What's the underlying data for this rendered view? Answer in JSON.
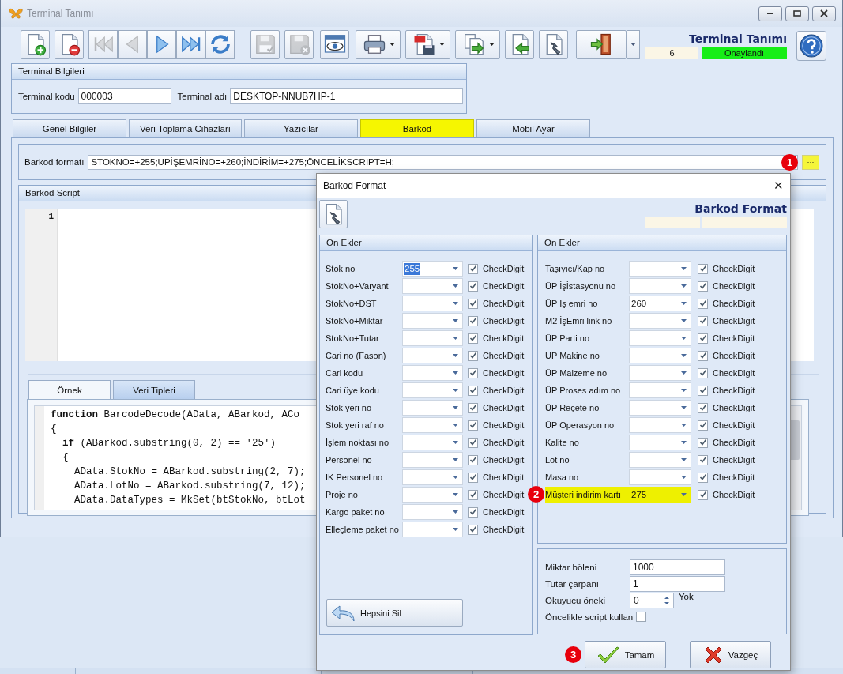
{
  "window": {
    "title": "Terminal Tanımı"
  },
  "toolbar": {
    "buttons": [
      {
        "kind": "new",
        "disabled": false,
        "dropdown": false
      },
      {
        "kind": "delete",
        "disabled": false,
        "dropdown": false
      },
      {
        "kind": "first",
        "disabled": true,
        "dropdown": false
      },
      {
        "kind": "prev",
        "disabled": true,
        "dropdown": false
      },
      {
        "kind": "next",
        "disabled": false,
        "dropdown": false
      },
      {
        "kind": "last",
        "disabled": false,
        "dropdown": false
      },
      {
        "kind": "refresh",
        "disabled": false,
        "dropdown": false
      },
      {
        "kind": "save",
        "disabled": true,
        "dropdown": false
      },
      {
        "kind": "save-cancel",
        "disabled": true,
        "dropdown": false
      },
      {
        "kind": "preview",
        "disabled": false,
        "dropdown": false
      },
      {
        "kind": "print",
        "disabled": false,
        "dropdown": true
      },
      {
        "kind": "pdf",
        "disabled": false,
        "dropdown": true
      },
      {
        "kind": "copy",
        "disabled": false,
        "dropdown": true
      },
      {
        "kind": "import",
        "disabled": false,
        "dropdown": false
      },
      {
        "kind": "tools",
        "disabled": false,
        "dropdown": false
      },
      {
        "kind": "exit",
        "disabled": false,
        "dropdown": true
      }
    ],
    "header": {
      "title": "Terminal Tanımı",
      "number": "6",
      "status": "Onaylandı"
    }
  },
  "terminal_info": {
    "title": "Terminal Bilgileri",
    "fields": [
      {
        "label": "Terminal kodu",
        "value": "000003"
      },
      {
        "label": "Terminal adı",
        "value": "DESKTOP-NNUB7HP-1"
      }
    ]
  },
  "tabs": [
    {
      "label": "Genel Bilgiler",
      "selected": false
    },
    {
      "label": "Veri Toplama Cihazları",
      "selected": false
    },
    {
      "label": "Yazıcılar",
      "selected": false
    },
    {
      "label": "Barkod",
      "selected": true
    },
    {
      "label": "Mobil Ayar",
      "selected": false
    }
  ],
  "barcode_format": {
    "label": "Barkod formatı",
    "value": "STOKNO=+255;UPİŞEMRİNO=+260;İNDİRİM=+275;ÖNCELİKSCRIPT=H;",
    "button": "···",
    "badge": "1"
  },
  "barcode_script": {
    "title": "Barkod Script",
    "line_numbers": [
      "1"
    ],
    "example_tabs": [
      {
        "label": "Örnek",
        "selected": true
      },
      {
        "label": "Veri Tipleri",
        "selected": false
      }
    ],
    "code": [
      "**function** BarcodeDecode(AData, ABarkod, ACo",
      "{",
      "  **if** (ABarkod.substring(0, 2) == '25')",
      "  {",
      "    AData.StokNo = ABarkod.substring(2, 7);",
      "    AData.LotNo = ABarkod.substring(7, 12);",
      "    AData.DataTypes = MkSet(btStokNo, btLot"
    ]
  },
  "dialog": {
    "title": "Barkod Format",
    "close": "✕",
    "header": "Barkod Format",
    "left": {
      "title": "Ön Ekler",
      "rows": [
        {
          "label": "Stok no",
          "value": "255",
          "value_selected": true,
          "checked": true,
          "check_label": "CheckDigit",
          "highlighted": false
        },
        {
          "label": "StokNo+Varyant",
          "value": "",
          "value_selected": false,
          "checked": true,
          "check_label": "CheckDigit",
          "highlighted": false
        },
        {
          "label": "StokNo+DST",
          "value": "",
          "value_selected": false,
          "checked": true,
          "check_label": "CheckDigit",
          "highlighted": false
        },
        {
          "label": "StokNo+Miktar",
          "value": "",
          "value_selected": false,
          "checked": true,
          "check_label": "CheckDigit",
          "highlighted": false
        },
        {
          "label": "StokNo+Tutar",
          "value": "",
          "value_selected": false,
          "checked": true,
          "check_label": "CheckDigit",
          "highlighted": false
        },
        {
          "label": "Cari no (Fason)",
          "value": "",
          "value_selected": false,
          "checked": true,
          "check_label": "CheckDigit",
          "highlighted": false
        },
        {
          "label": "Cari kodu",
          "value": "",
          "value_selected": false,
          "checked": true,
          "check_label": "CheckDigit",
          "highlighted": false
        },
        {
          "label": "Cari üye kodu",
          "value": "",
          "value_selected": false,
          "checked": true,
          "check_label": "CheckDigit",
          "highlighted": false
        },
        {
          "label": "Stok yeri no",
          "value": "",
          "value_selected": false,
          "checked": true,
          "check_label": "CheckDigit",
          "highlighted": false
        },
        {
          "label": "Stok yeri raf no",
          "value": "",
          "value_selected": false,
          "checked": true,
          "check_label": "CheckDigit",
          "highlighted": false
        },
        {
          "label": "İşlem noktası no",
          "value": "",
          "value_selected": false,
          "checked": true,
          "check_label": "CheckDigit",
          "highlighted": false
        },
        {
          "label": "Personel no",
          "value": "",
          "value_selected": false,
          "checked": true,
          "check_label": "CheckDigit",
          "highlighted": false
        },
        {
          "label": "IK Personel no",
          "value": "",
          "value_selected": false,
          "checked": true,
          "check_label": "CheckDigit",
          "highlighted": false
        },
        {
          "label": "Proje no",
          "value": "",
          "value_selected": false,
          "checked": true,
          "check_label": "CheckDigit",
          "highlighted": false
        },
        {
          "label": "Kargo paket no",
          "value": "",
          "value_selected": false,
          "checked": true,
          "check_label": "CheckDigit",
          "highlighted": false
        },
        {
          "label": "Elleçleme paket no",
          "value": "",
          "value_selected": false,
          "checked": true,
          "check_label": "CheckDigit",
          "highlighted": false
        }
      ],
      "clear_button": "Hepsini Sil"
    },
    "right": {
      "title": "Ön Ekler",
      "rows": [
        {
          "label": "Taşıyıcı/Kap no",
          "value": "",
          "value_selected": false,
          "checked": true,
          "check_label": "CheckDigit",
          "highlighted": false
        },
        {
          "label": "ÜP İşİstasyonu no",
          "value": "",
          "value_selected": false,
          "checked": true,
          "check_label": "CheckDigit",
          "highlighted": false
        },
        {
          "label": "ÜP İş emri no",
          "value": "260",
          "value_selected": false,
          "checked": true,
          "check_label": "CheckDigit",
          "highlighted": false
        },
        {
          "label": "M2 İşEmri link no",
          "value": "",
          "value_selected": false,
          "checked": true,
          "check_label": "CheckDigit",
          "highlighted": false
        },
        {
          "label": "ÜP Parti no",
          "value": "",
          "value_selected": false,
          "checked": true,
          "check_label": "CheckDigit",
          "highlighted": false
        },
        {
          "label": "ÜP Makine no",
          "value": "",
          "value_selected": false,
          "checked": true,
          "check_label": "CheckDigit",
          "highlighted": false
        },
        {
          "label": "ÜP Malzeme no",
          "value": "",
          "value_selected": false,
          "checked": true,
          "check_label": "CheckDigit",
          "highlighted": false
        },
        {
          "label": "ÜP Proses adım no",
          "value": "",
          "value_selected": false,
          "checked": true,
          "check_label": "CheckDigit",
          "highlighted": false
        },
        {
          "label": "ÜP Reçete no",
          "value": "",
          "value_selected": false,
          "checked": true,
          "check_label": "CheckDigit",
          "highlighted": false
        },
        {
          "label": "ÜP Operasyon no",
          "value": "",
          "value_selected": false,
          "checked": true,
          "check_label": "CheckDigit",
          "highlighted": false
        },
        {
          "label": "Kalite no",
          "value": "",
          "value_selected": false,
          "checked": true,
          "check_label": "CheckDigit",
          "highlighted": false
        },
        {
          "label": "Lot no",
          "value": "",
          "value_selected": false,
          "checked": true,
          "check_label": "CheckDigit",
          "highlighted": false
        },
        {
          "label": "Masa no",
          "value": "",
          "value_selected": false,
          "checked": true,
          "check_label": "CheckDigit",
          "highlighted": false
        },
        {
          "label": "Müşteri indirim kartı",
          "value": "275",
          "value_selected": false,
          "checked": true,
          "check_label": "CheckDigit",
          "highlighted": true,
          "badge": "2"
        }
      ]
    },
    "settings": [
      {
        "kind": "text",
        "label": "Miktar böleni",
        "value": "1000"
      },
      {
        "kind": "text",
        "label": "Tutar çarpanı",
        "value": "1"
      },
      {
        "kind": "spin",
        "label": "Okuyucu öneki",
        "value": "0",
        "note": "Yok"
      },
      {
        "kind": "checkbox",
        "label": "Öncelikle script kullan",
        "checked": false
      }
    ],
    "buttons": [
      {
        "kind": "ok",
        "label": "Tamam",
        "badge": "3"
      },
      {
        "kind": "cancel",
        "label": "Vazgeç"
      }
    ]
  }
}
